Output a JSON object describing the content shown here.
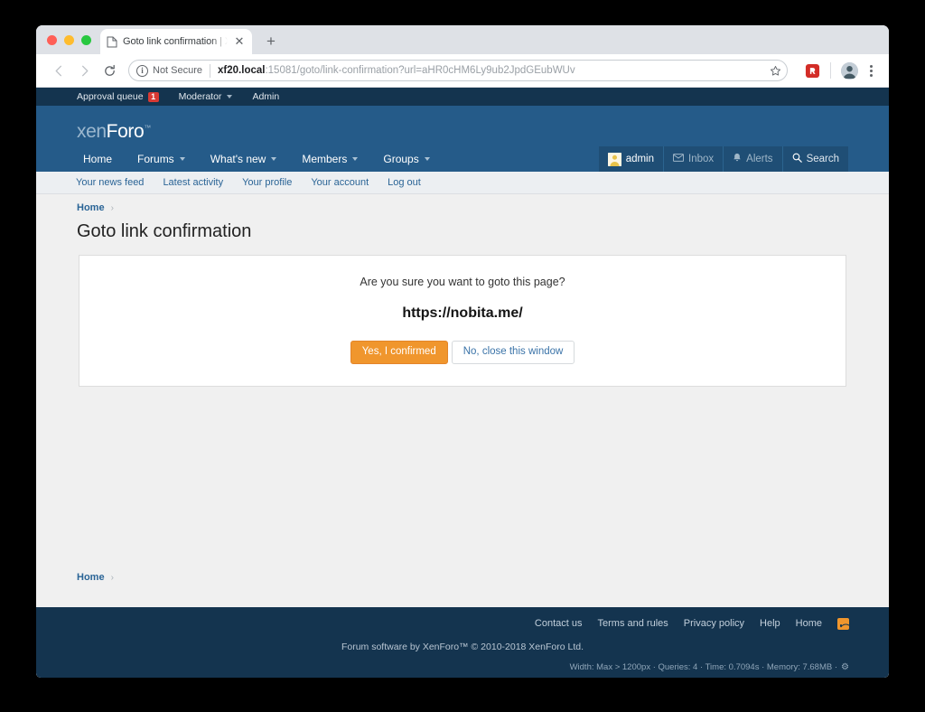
{
  "browser": {
    "tab": {
      "title": "Goto link confirmation | XenForo",
      "favicon": "document-icon",
      "close_label": "✕"
    },
    "new_tab_label": "+",
    "toolbar": {
      "back_label": "←",
      "forward_label": "→",
      "reload_label": "↻",
      "security_text": "Not Secure",
      "security_icon": "info-circle-icon",
      "url_host": "xf20.local",
      "url_rest": ":15081/goto/link-confirmation?url=aHR0cHM6Ly9ub2JpdGEubWUv",
      "bookmark_icon": "star-icon",
      "extension_icon": "lastpass-extension-icon",
      "profile_icon": "profile-avatar-icon",
      "menu_icon": "three-dot-menu-icon"
    }
  },
  "staff_bar": {
    "approval_queue_label": "Approval queue",
    "approval_queue_count": "1",
    "moderator_label": "Moderator",
    "admin_label": "Admin"
  },
  "header": {
    "logo_dim": "xen",
    "logo_lit": "Foro",
    "logo_tm": "™"
  },
  "nav": {
    "items": [
      {
        "label": "Home",
        "has_caret": false
      },
      {
        "label": "Forums",
        "has_caret": true
      },
      {
        "label": "What's new",
        "has_caret": true
      },
      {
        "label": "Members",
        "has_caret": true
      },
      {
        "label": "Groups",
        "has_caret": true
      }
    ],
    "visitor": {
      "username": "admin",
      "inbox_label": "Inbox",
      "alerts_label": "Alerts",
      "search_label": "Search"
    }
  },
  "subnav": {
    "links": [
      "Your news feed",
      "Latest activity",
      "Your profile",
      "Your account",
      "Log out"
    ]
  },
  "breadcrumb": {
    "home_label": "Home",
    "separator": "›"
  },
  "page": {
    "title": "Goto link confirmation"
  },
  "confirm": {
    "question": "Are you sure you want to goto this page?",
    "target_url": "https://nobita.me/",
    "confirm_button": "Yes, I confirmed",
    "cancel_button": "No, close this window"
  },
  "footer": {
    "links": [
      "Contact us",
      "Terms and rules",
      "Privacy policy",
      "Help",
      "Home"
    ],
    "rss_icon": "rss-feed-icon",
    "copyright": "Forum software by XenForo™ © 2010-2018 XenForo Ltd.",
    "debug": "Width: Max > 1200px · Queries: 4 · Time: 0.7094s · Memory: 7.68MB ·",
    "debug_gear": "⚙"
  },
  "colors": {
    "staff_bar": "#14344f",
    "header_blue": "#255b89",
    "accent_orange": "#f0962d",
    "link_blue": "#2a6496",
    "badge_red": "#d83a34",
    "page_bg": "#f0f0f0"
  }
}
